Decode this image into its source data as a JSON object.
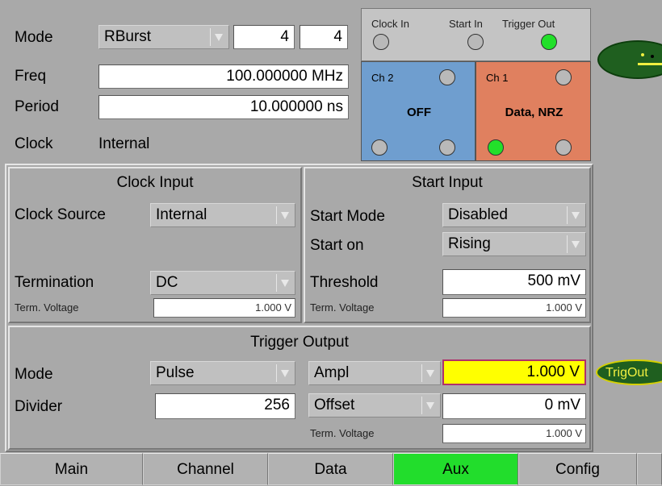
{
  "top": {
    "mode_label": "Mode",
    "mode_value": "RBurst",
    "burst_a": "4",
    "burst_b": "4",
    "freq_label": "Freq",
    "freq_value": "100.000000 MHz",
    "period_label": "Period",
    "period_value": "10.000000 ns",
    "clock_label": "Clock",
    "clock_value": "Internal"
  },
  "io_status": {
    "clock_in": "Clock In",
    "start_in": "Start In",
    "trigger_out": "Trigger Out",
    "clock_in_led": false,
    "start_in_led": false,
    "trigger_out_led": true
  },
  "channels": {
    "ch2": {
      "label": "Ch 2",
      "state": "OFF",
      "color": "#6f9ecf"
    },
    "ch1": {
      "label": "Ch 1",
      "state": "Data, NRZ",
      "color": "#e0805f"
    }
  },
  "clock_input": {
    "title": "Clock Input",
    "source_label": "Clock Source",
    "source_value": "Internal",
    "termination_label": "Termination",
    "termination_value": "DC",
    "term_voltage_label": "Term. Voltage",
    "term_voltage_value": "1.000 V"
  },
  "start_input": {
    "title": "Start Input",
    "mode_label": "Start Mode",
    "mode_value": "Disabled",
    "on_label": "Start on",
    "on_value": "Rising",
    "threshold_label": "Threshold",
    "threshold_value": "500 mV",
    "term_voltage_label": "Term. Voltage",
    "term_voltage_value": "1.000 V"
  },
  "trigger_output": {
    "title": "Trigger Output",
    "mode_label": "Mode",
    "mode_value": "Pulse",
    "divider_label": "Divider",
    "divider_value": "256",
    "ampl_label": "Ampl",
    "ampl_value": "1.000 V",
    "offset_label": "Offset",
    "offset_value": "0 mV",
    "term_voltage_label": "Term. Voltage",
    "term_voltage_value": "1.000 V",
    "ampl_highlight": "#ffff00"
  },
  "side": {
    "trigout_label": "TrigOut"
  },
  "tabs": [
    {
      "label": "Main"
    },
    {
      "label": "Channel"
    },
    {
      "label": "Data"
    },
    {
      "label": "Aux"
    },
    {
      "label": "Config"
    }
  ],
  "active_tab": "Aux"
}
